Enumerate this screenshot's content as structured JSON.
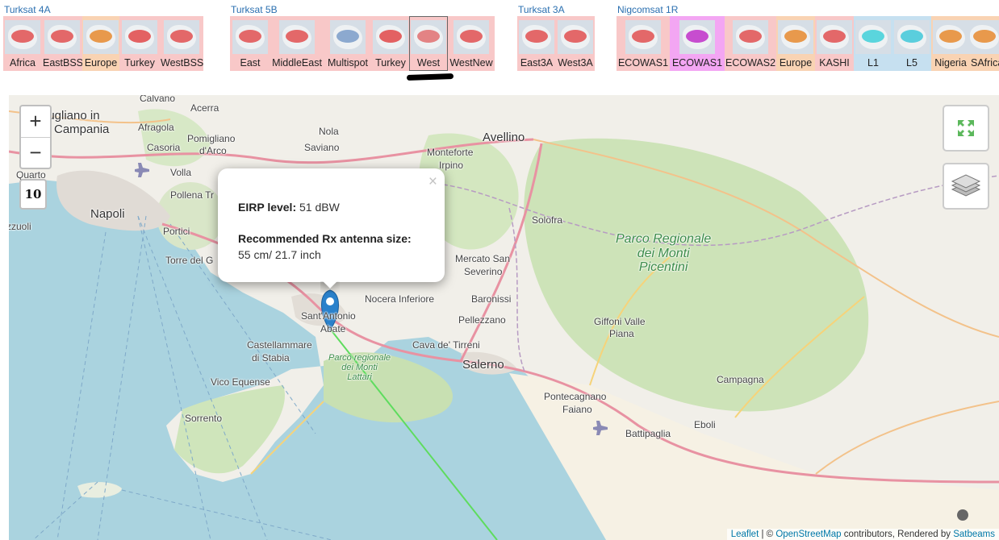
{
  "satellites": [
    {
      "name": "Turksat 4A",
      "beams": [
        {
          "label": "Africa",
          "bg": "#f8c8c8",
          "blob": "#e05050"
        },
        {
          "label": "EastBSS",
          "bg": "#f8c8c8",
          "blob": "#e05050"
        },
        {
          "label": "Europe",
          "bg": "#f9d3b3",
          "blob": "#e68a2e"
        },
        {
          "label": "Turkey",
          "bg": "#f8c8c8",
          "blob": "#e04848"
        },
        {
          "label": "WestBSS",
          "bg": "#f8c8c8",
          "blob": "#e05050"
        }
      ]
    },
    {
      "name": "Turksat 5B",
      "beams": [
        {
          "label": "East",
          "bg": "#f8c8c8",
          "blob": "#e05050"
        },
        {
          "label": "MiddleEast",
          "bg": "#f8c8c8",
          "blob": "#e05050"
        },
        {
          "label": "Multispot",
          "bg": "#f8c8c8",
          "blob": "#7a9cc8"
        },
        {
          "label": "Turkey",
          "bg": "#f8c8c8",
          "blob": "#e04848"
        },
        {
          "label": "West",
          "bg": "#f8c8c8",
          "blob": "#e07070",
          "selected": true
        },
        {
          "label": "WestNew",
          "bg": "#f8c8c8",
          "blob": "#e05050"
        }
      ]
    },
    {
      "name": "Turksat 3A",
      "beams": [
        {
          "label": "East3A",
          "bg": "#f8c8c8",
          "blob": "#e05050"
        },
        {
          "label": "West3A",
          "bg": "#f8c8c8",
          "blob": "#e05050"
        }
      ]
    },
    {
      "name": "Nigcomsat 1R",
      "beams": [
        {
          "label": "ECOWAS1",
          "bg": "#f8c8c8",
          "blob": "#e05050"
        },
        {
          "label": "ECOWAS1",
          "bg": "#f3a6f3",
          "blob": "#c030c8"
        },
        {
          "label": "ECOWAS2",
          "bg": "#f8c8c8",
          "blob": "#e05050"
        },
        {
          "label": "Europe",
          "bg": "#f9d3b3",
          "blob": "#e68a2e"
        },
        {
          "label": "KASHI",
          "bg": "#f8c8c8",
          "blob": "#e05050"
        },
        {
          "label": "L1",
          "bg": "#c6e0f0",
          "blob": "#40d0d8"
        },
        {
          "label": "L5",
          "bg": "#c6e0f0",
          "blob": "#40c8d8"
        },
        {
          "label": "Nigeria",
          "bg": "#f9d3b3",
          "blob": "#e68a2e"
        },
        {
          "label": "SAfrica",
          "bg": "#f9d3b3",
          "blob": "#e68a2e"
        }
      ]
    }
  ],
  "map": {
    "zoom_in": "+",
    "zoom_out": "−",
    "zoom_level": "10",
    "popup": {
      "close": "×",
      "eirp_label": "EIRP level:",
      "eirp_value": "51 dBW",
      "antenna_label": "Recommended Rx antenna size:",
      "antenna_value": "55 cm/ 21.7 inch"
    },
    "attribution": {
      "leaflet": "Leaflet",
      "sep": " | © ",
      "osm": "OpenStreetMap",
      "contrib": " contributors, Rendered by ",
      "satbeams": "Satbeams"
    },
    "places": [
      {
        "name": "Calvano"
      },
      {
        "name": "Acerra"
      },
      {
        "name": "iugliano in"
      },
      {
        "name": "Campania"
      },
      {
        "name": "Afragola"
      },
      {
        "name": "Pomigliano"
      },
      {
        "name": "d'Arco"
      },
      {
        "name": "Nola"
      },
      {
        "name": "Casoria"
      },
      {
        "name": "Saviano"
      },
      {
        "name": "Volla"
      },
      {
        "name": "Pollena Tr"
      },
      {
        "name": "Quarto"
      },
      {
        "name": "Napoli"
      },
      {
        "name": "Portici"
      },
      {
        "name": "zzuoli"
      },
      {
        "name": "Torre del G"
      },
      {
        "name": "Avellino"
      },
      {
        "name": "Monteforte"
      },
      {
        "name": "Irpino"
      },
      {
        "name": "Solofra"
      },
      {
        "name": "Mercato San"
      },
      {
        "name": "Severino"
      },
      {
        "name": "Baronissi"
      },
      {
        "name": "Pellezzano"
      },
      {
        "name": "Nocera Inferiore"
      },
      {
        "name": "Sant'Antonio"
      },
      {
        "name": "Abate"
      },
      {
        "name": "Castellammare"
      },
      {
        "name": "di Stabia"
      },
      {
        "name": "Cava de' Tirreni"
      },
      {
        "name": "Salerno"
      },
      {
        "name": "Vico Equense"
      },
      {
        "name": "Sorrento"
      },
      {
        "name": "Giffoni Valle"
      },
      {
        "name": "Piana"
      },
      {
        "name": "Pontecagnano"
      },
      {
        "name": "Faiano"
      },
      {
        "name": "Battipaglia"
      },
      {
        "name": "Eboli"
      },
      {
        "name": "Campagna"
      }
    ],
    "parks": [
      {
        "line1": "Parco Regionale",
        "line2": "dei Monti",
        "line3": "Picentini"
      },
      {
        "line1": "Parco regionale",
        "line2": "dei Monti",
        "line3": "Lattari"
      }
    ]
  }
}
